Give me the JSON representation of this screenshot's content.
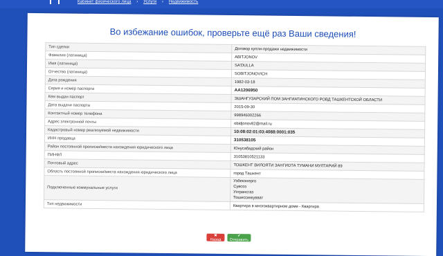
{
  "breadcrumb": {
    "items": [
      "Кабинет физического лица",
      "Услуги",
      "Недвижимость"
    ]
  },
  "title": "Во избежание ошибок, проверьте ещё раз Ваши сведения!",
  "rows": [
    {
      "label": "Тип сделки",
      "value": "Договор купли-продажи недвижимости"
    },
    {
      "label": "Фамилия (латиница)",
      "value": "ABITJONOV"
    },
    {
      "label": "Имя (латиница)",
      "value": "SA'DULLA"
    },
    {
      "label": "Отчество (латиница)",
      "value": "SOBITJONOVICH"
    },
    {
      "label": "Дата рождения",
      "value": "1982-03-18"
    },
    {
      "label": "Серия и номер паспорта",
      "value": "AA1206950"
    },
    {
      "label": "Кем выдан паспорт",
      "value": "ЭШАНГУЗАРСКИЙ ПОМ ЗАНГИАТИНСКОГО РОВД ТАШКЕНТСКОЙ ОБЛАСТИ"
    },
    {
      "label": "Дата выдачи паспорта",
      "value": "2015-09-30"
    },
    {
      "label": "Контактный номер телефона",
      "value": "998946002266"
    },
    {
      "label": "Адрес электронной почты",
      "value": "obidjonov82@mail.ru"
    },
    {
      "label": "Кадастровый номер реализуемой недвижимости",
      "value": "10:08:02:01:03:4088:0001:035"
    },
    {
      "label": "ИНН продавца",
      "value": "310538105"
    },
    {
      "label": "Район постоянной прописки/места нахождения юридического лица",
      "value": "Юнусабадский район"
    },
    {
      "label": "ПИНФЛ",
      "value": "31053810521133"
    },
    {
      "label": "Почтовый адрес",
      "value": "ТОШКЕНТ ВИЛОЯТИ ЗАНГИОТА ТУМАНИ МУЛТАРИЙ 89"
    },
    {
      "label": "Область постоянной прописки/места нахождения юридического лица",
      "value": "город Ташкент"
    }
  ],
  "utilities": {
    "label": "Подключенные коммунальные услуги",
    "values": [
      "Узбекэнерго",
      "Сувсоз",
      "Узтрансгаз",
      "Тошиссиккувват"
    ]
  },
  "property_type": {
    "label": "Тип недвижимости",
    "value": "Квартира в многоквартирном доме - Квартира"
  },
  "buttons": {
    "back_label": "✖ Назад",
    "send_label": "✔ Отправить"
  },
  "colors": {
    "background": "#1f4fb8",
    "title": "#1f4fb8",
    "back_button": "#d9403a",
    "send_button": "#4aa24a"
  }
}
